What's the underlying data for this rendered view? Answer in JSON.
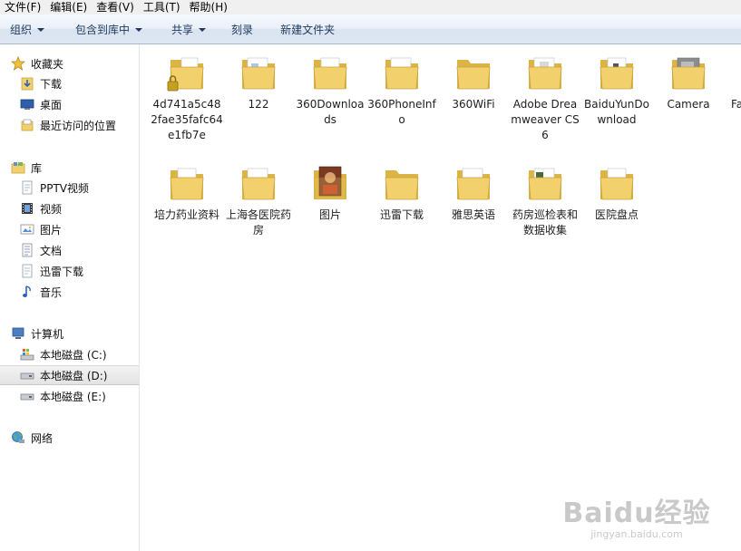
{
  "menu": [
    "文件(F)",
    "编辑(E)",
    "查看(V)",
    "工具(T)",
    "帮助(H)"
  ],
  "toolbar": {
    "organize": "组织",
    "include_in_library": "包含到库中",
    "share": "共享",
    "burn": "刻录",
    "new_folder": "新建文件夹"
  },
  "nav": {
    "favorites": "收藏夹",
    "downloads": "下载",
    "desktop": "桌面",
    "recent": "最近访问的位置",
    "libraries": "库",
    "pptv": "PPTV视频",
    "videos": "视频",
    "pictures": "图片",
    "documents": "文档",
    "thunder": "迅雷下载",
    "music": "音乐",
    "computer": "计算机",
    "disk_c": "本地磁盘 (C:)",
    "disk_d": "本地磁盘 (D:)",
    "disk_e": "本地磁盘 (E:)",
    "network": "网络"
  },
  "files": [
    "4d741a5c482fae35fafc64e1fb7e",
    "122",
    "360Downloads",
    "360PhoneInfo",
    "360WiFi",
    "Adobe Dreamweaver CS6",
    "BaiduYunDownload",
    "Camera",
    "Fa",
    "培力药业资料",
    "上海各医院药房",
    "图片",
    "迅雷下载",
    "雅思英语",
    "药房巡检表和数据收集",
    "医院盘点"
  ],
  "watermark": {
    "brand": "Baidu经验",
    "url": "jingyan.baidu.com"
  },
  "colors": {
    "folder": "#f2d06b",
    "folder_dark": "#dcb345",
    "toolbar_text": "#1e395b",
    "selected_nav": "#e6e6e6"
  }
}
